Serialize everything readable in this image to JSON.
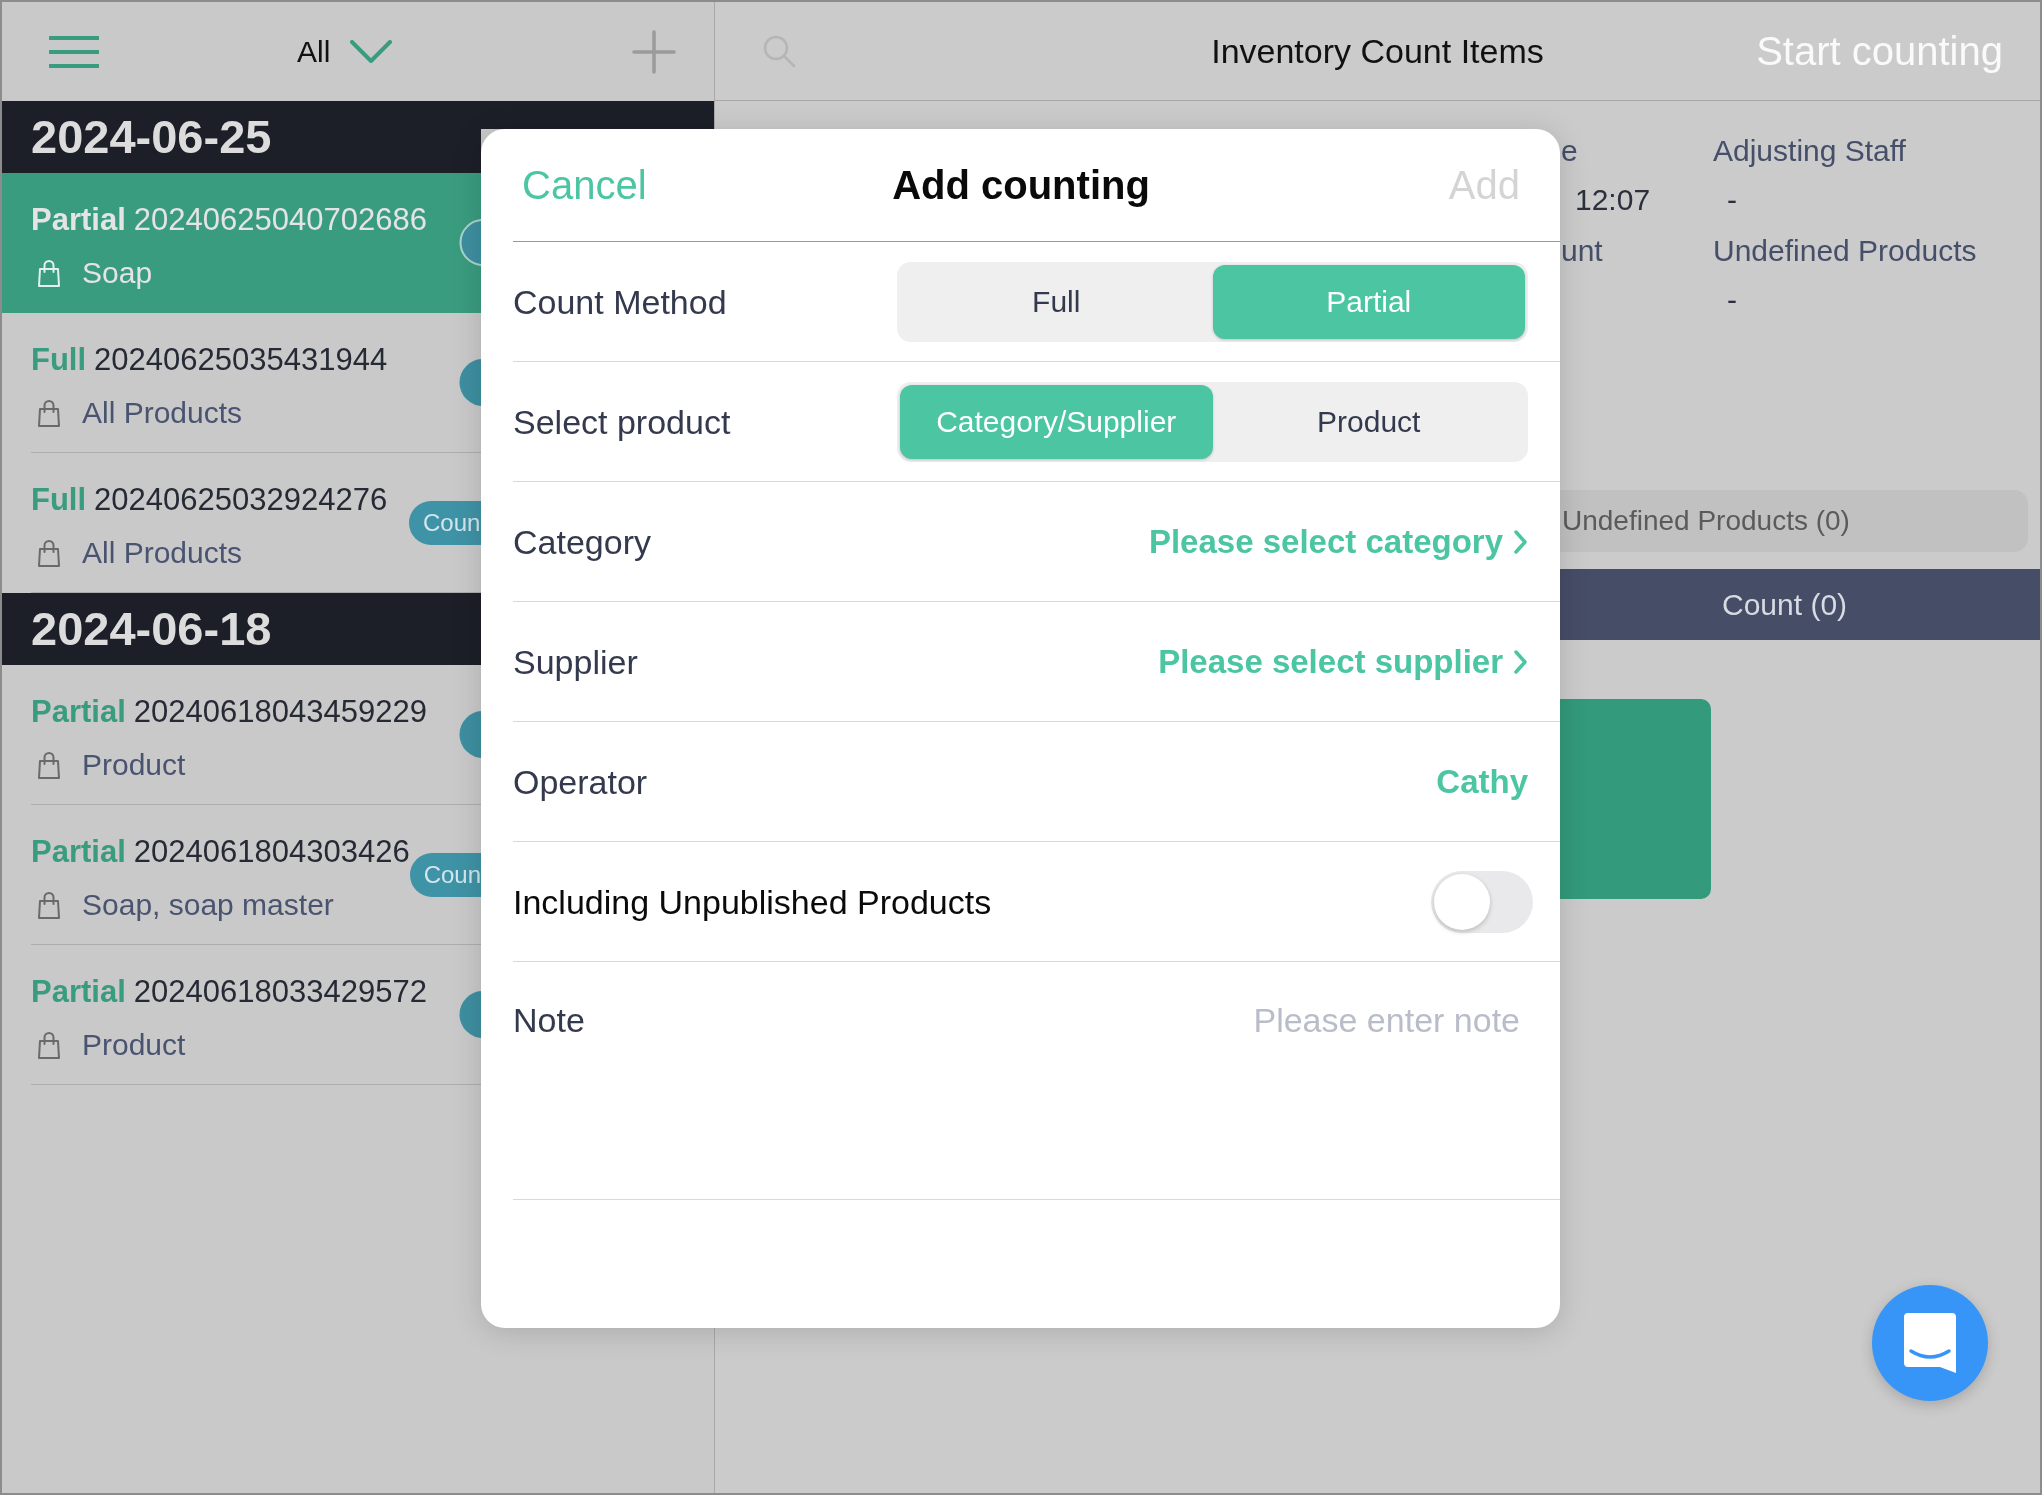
{
  "sidebar": {
    "filter": {
      "label": "All"
    },
    "groups": [
      {
        "date": "2024-06-25",
        "items": [
          {
            "method": "Partial",
            "number": "20240625040702686",
            "scope": "Soap",
            "selected": true,
            "badge": {
              "kind": "circle"
            }
          },
          {
            "method": "Full",
            "number": "20240625035431944",
            "scope": "All Products",
            "selected": false,
            "badge": {
              "kind": "circle"
            }
          },
          {
            "method": "Full",
            "number": "20240625032924276",
            "scope": "All Products",
            "selected": false,
            "badge": {
              "kind": "pill",
              "label": "Coun"
            }
          }
        ]
      },
      {
        "date": "2024-06-18",
        "items": [
          {
            "method": "Partial",
            "number": "20240618043459229",
            "scope": "Product",
            "selected": false,
            "badge": {
              "kind": "circle"
            }
          },
          {
            "method": "Partial",
            "number": "2024061804303426",
            "scope": "Soap, soap master",
            "selected": false,
            "badge": {
              "kind": "pill",
              "label": "Coun"
            }
          },
          {
            "method": "Partial",
            "number": "20240618033429572",
            "scope": "Product",
            "selected": false,
            "badge": {
              "kind": "circle"
            }
          }
        ]
      }
    ]
  },
  "main": {
    "title": "Inventory Count Items",
    "action": {
      "label": "Start counting",
      "disabled": true
    },
    "details": [
      {
        "label": "e",
        "value": "12:07"
      },
      {
        "label": "Adjusting Staff",
        "value": "-"
      },
      {
        "label": "unt"
      },
      {
        "label": "Undefined Products",
        "value": "-"
      }
    ],
    "tabs": [
      {
        "label": "Undefined Products (0)",
        "selected": false
      }
    ],
    "list_header": "Count (0)"
  },
  "dialog": {
    "cancel": "Cancel",
    "title": "Add counting",
    "confirm": {
      "label": "Add",
      "disabled": true
    },
    "rows": [
      {
        "kind": "segmented",
        "label": "Count Method",
        "options": [
          {
            "label": "Full",
            "selected": false
          },
          {
            "label": "Partial",
            "selected": true
          }
        ]
      },
      {
        "kind": "segmented",
        "label": "Select product",
        "options": [
          {
            "label": "Category/Supplier",
            "selected": true
          },
          {
            "label": "Product",
            "selected": false
          }
        ]
      },
      {
        "kind": "link",
        "label": "Category",
        "value": "Please select category"
      },
      {
        "kind": "link",
        "label": "Supplier",
        "value": "Please select supplier"
      },
      {
        "kind": "value",
        "label": "Operator",
        "value": "Cathy"
      },
      {
        "kind": "switch",
        "label": "Including Unpublished Products",
        "on": false
      },
      {
        "kind": "textarea",
        "label": "Note",
        "placeholder": "Please enter note"
      }
    ]
  }
}
